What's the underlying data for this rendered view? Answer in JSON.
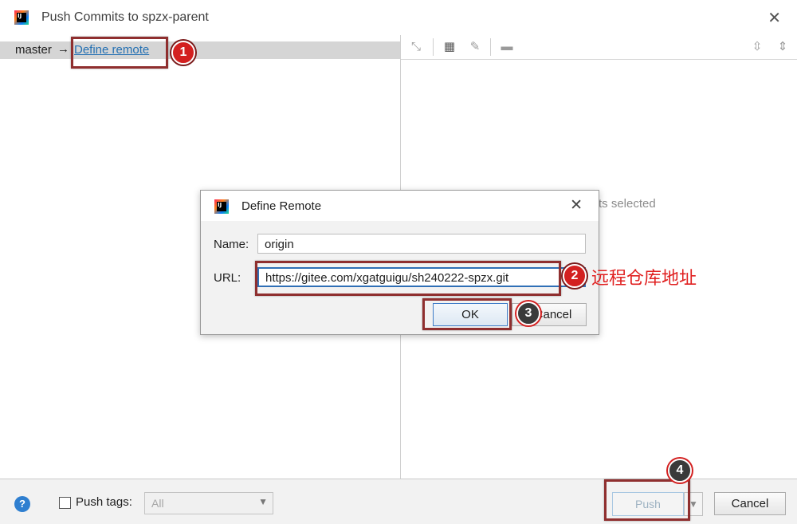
{
  "window": {
    "title": "Push Commits to spzx-parent"
  },
  "branch": {
    "name": "master",
    "arrow": "→",
    "define_remote_link": "Define remote"
  },
  "detail_panel": {
    "empty_text": "ts selected"
  },
  "toolbar": {
    "icons": [
      "expand-arrows-icon",
      "group-icon",
      "edit-icon",
      "preview-icon",
      "expand-all-icon",
      "collapse-all-icon"
    ]
  },
  "bottom": {
    "help_label": "?",
    "push_tags_label": "Push tags:",
    "tags_value": "All",
    "push_label": "Push",
    "cancel_label": "Cancel"
  },
  "dialog": {
    "title": "Define Remote",
    "name_label": "Name:",
    "name_value": "origin",
    "url_label": "URL:",
    "url_value": "https://gitee.com/xgatguigu/sh240222-spzx.git",
    "ok_label": "OK",
    "cancel_label": "Cancel"
  },
  "annotations": {
    "markers": [
      "1",
      "2",
      "3",
      "4"
    ],
    "url_note": "远程仓库地址",
    "color": "#d32020"
  }
}
